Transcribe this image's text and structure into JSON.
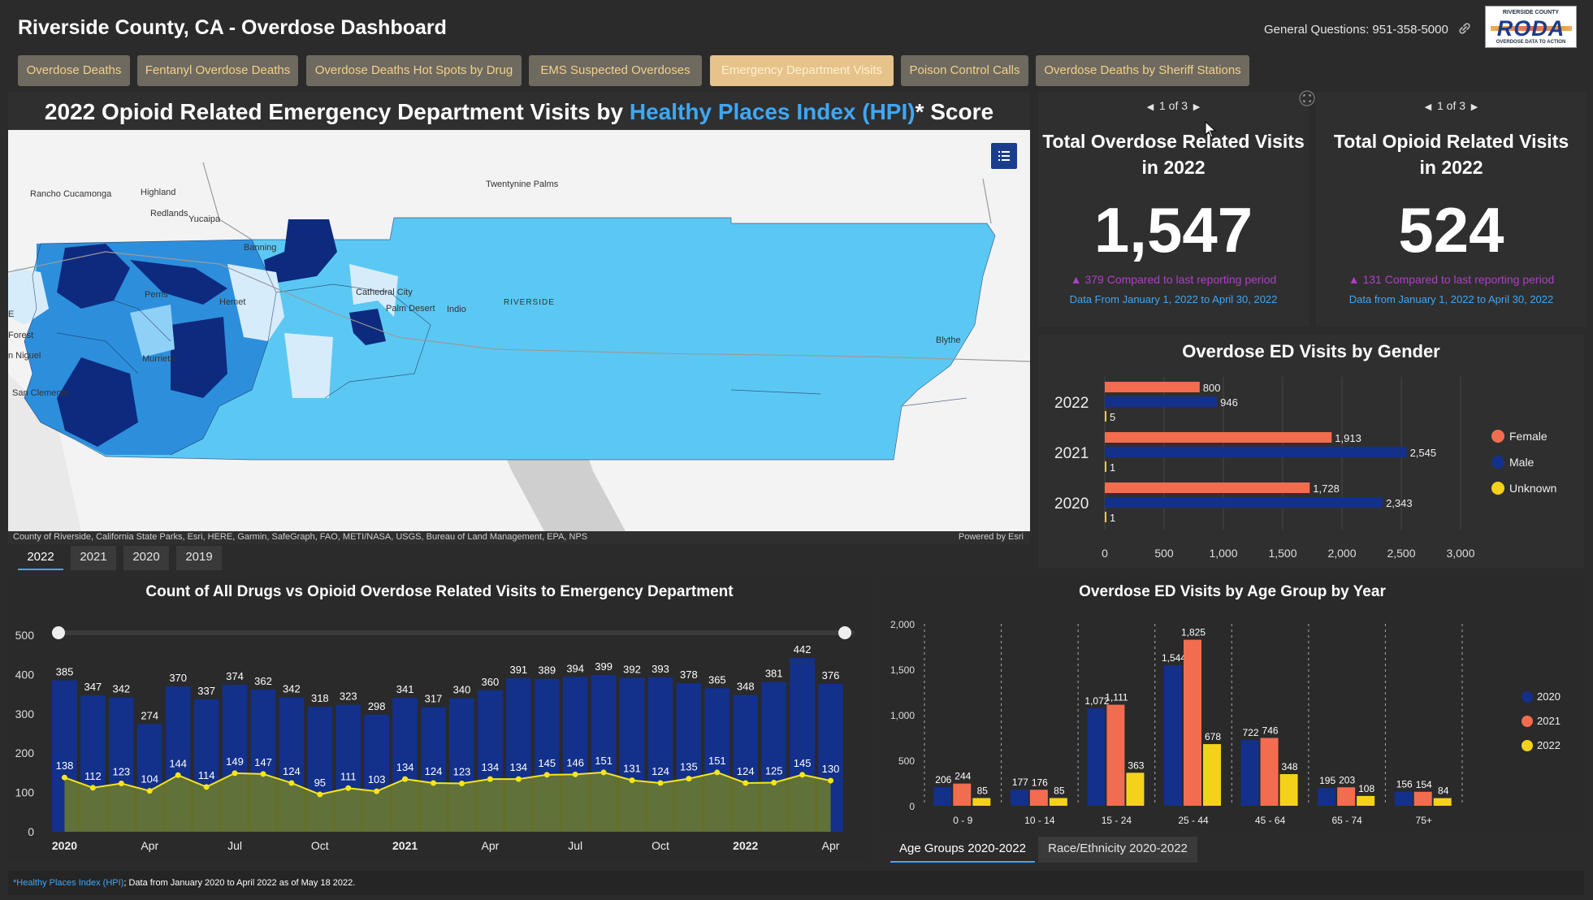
{
  "header": {
    "title": "Riverside County, CA - Overdose Dashboard",
    "contact": "General Questions: 951-358-5000",
    "logo": {
      "top": "RIVERSIDE COUNTY",
      "name": "RODA",
      "tagline": "OVERDOSE DATA TO ACTION"
    }
  },
  "tabs": [
    {
      "label": "Overdose Deaths"
    },
    {
      "label": "Fentanyl Overdose Deaths"
    },
    {
      "label": "Overdose Deaths Hot Spots by Drug"
    },
    {
      "label": "EMS Suspected Overdoses"
    },
    {
      "label": "Emergency Department Visits"
    },
    {
      "label": "Poison Control Calls"
    },
    {
      "label": "Overdose Deaths by Sheriff Stations"
    }
  ],
  "map": {
    "title_pre": "2022 Opioid Related Emergency Department Visits by ",
    "title_link": "Healthy Places Index (HPI)",
    "title_post": "* Score",
    "attribution": "County of Riverside, California State Parks, Esri, HERE, Garmin, SafeGraph, FAO, METI/NASA, USGS, Bureau of Land Management, EPA, NPS",
    "powered": "Powered by Esri",
    "places": [
      "Rancho Cucamonga",
      "Highland",
      "Redlands",
      "Yucaipa",
      "Twentynine Palms",
      "Banning",
      "Cathedral City",
      "Palm Desert",
      "Indio",
      "RIVERSIDE",
      "Hemet",
      "Perris",
      "Murrieta",
      "Blythe",
      "Forest",
      "n Niguel",
      "San Clemente",
      "E"
    ]
  },
  "year_tabs": [
    "2022",
    "2021",
    "2020",
    "2019"
  ],
  "kpi_left": {
    "pager": "1 of 3",
    "title_line1": "Total Overdose Related Visits",
    "title_line2": "in 2022",
    "value": "1,547",
    "compare": "▲ 379 Compared to last reporting period",
    "range": "Data From January 1, 2022 to April 30, 2022"
  },
  "kpi_right": {
    "pager": "1 of 3",
    "title_line1": "Total Opioid Related Visits",
    "title_line2": "in 2022",
    "value": "524",
    "compare": "▲ 131 Compared to last reporting period",
    "range": "Data from January 1, 2022 to April 30, 2022"
  },
  "bottom_tabs": [
    "Age Groups 2020-2022",
    "Race/Ethnicity 2020-2022"
  ],
  "footer": {
    "asterisk": "*",
    "link": "Healthy Places Index (HPI)",
    "text": "; Data from January 2020 to April 2022 as of May 18 2022."
  },
  "colors": {
    "female": "#f26d4f",
    "male": "#13308b",
    "unknown": "#f5d21a",
    "y2020": "#13308b",
    "y2021": "#f26d4f",
    "y2022": "#f5d21a",
    "opioid_fill": "#6e7d2a",
    "opioid_line": "#f5e51a",
    "accent": "#3fa7f5"
  },
  "chart_data": [
    {
      "type": "bar",
      "orientation": "horizontal",
      "title": "Overdose ED Visits by Gender",
      "categories": [
        "2022",
        "2021",
        "2020"
      ],
      "series": [
        {
          "name": "Female",
          "values": [
            800,
            1913,
            1728
          ]
        },
        {
          "name": "Male",
          "values": [
            946,
            2545,
            2343
          ]
        },
        {
          "name": "Unknown",
          "values": [
            5,
            1,
            1
          ]
        }
      ],
      "xlim": [
        0,
        3000
      ],
      "xticks": [
        "0",
        "500",
        "1,000",
        "1,500",
        "2,000",
        "2,500",
        "3,000"
      ],
      "legend": "right"
    },
    {
      "type": "bar",
      "title": "Count of All Drugs vs Opioid Overdose Related Visits to Emergency Department",
      "x": [
        "2020-01",
        "2020-02",
        "2020-03",
        "2020-04",
        "2020-05",
        "2020-06",
        "2020-07",
        "2020-08",
        "2020-09",
        "2020-10",
        "2020-11",
        "2020-12",
        "2021-01",
        "2021-02",
        "2021-03",
        "2021-04",
        "2021-05",
        "2021-06",
        "2021-07",
        "2021-08",
        "2021-09",
        "2021-10",
        "2021-11",
        "2021-12",
        "2022-01",
        "2022-02",
        "2022-03",
        "2022-04"
      ],
      "series": [
        {
          "values": [
            385,
            347,
            342,
            274,
            370,
            337,
            374,
            362,
            342,
            318,
            323,
            298,
            341,
            317,
            340,
            360,
            391,
            389,
            394,
            399,
            392,
            393,
            378,
            365,
            348,
            381,
            442,
            376
          ]
        },
        {
          "values": [
            138,
            112,
            123,
            104,
            144,
            114,
            149,
            147,
            124,
            95,
            111,
            103,
            134,
            124,
            123,
            134,
            134,
            145,
            146,
            151,
            131,
            124,
            135,
            151,
            124,
            125,
            145,
            130
          ]
        }
      ],
      "ylim": [
        0,
        500
      ],
      "yticks": [
        "0",
        "100",
        "200",
        "300",
        "400",
        "500"
      ],
      "xtick_labels": [
        "2020",
        "Apr",
        "Jul",
        "Oct",
        "2021",
        "Apr",
        "Jul",
        "Oct",
        "2022",
        "Apr"
      ]
    },
    {
      "type": "bar",
      "title": "Overdose ED Visits by Age Group by Year",
      "categories": [
        "0 - 9",
        "10 - 14",
        "15 - 24",
        "25 - 44",
        "45 - 64",
        "65 - 74",
        "75+"
      ],
      "series": [
        {
          "name": "2020",
          "values": [
            206,
            177,
            1072,
            1544,
            722,
            195,
            156
          ]
        },
        {
          "name": "2021",
          "values": [
            244,
            176,
            1111,
            1825,
            746,
            203,
            154
          ]
        },
        {
          "name": "2022",
          "values": [
            85,
            85,
            363,
            678,
            348,
            108,
            84
          ]
        }
      ],
      "ylim": [
        0,
        2000
      ],
      "yticks": [
        "0",
        "500",
        "1,000",
        "1,500",
        "2,000"
      ],
      "legend": "right"
    }
  ]
}
